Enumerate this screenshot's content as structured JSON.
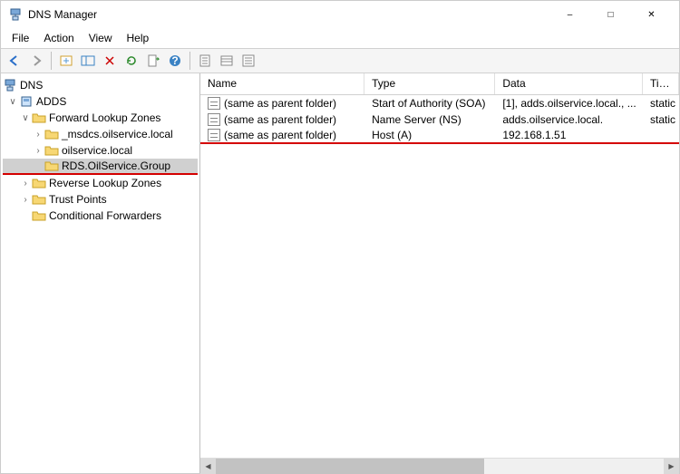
{
  "window": {
    "title": "DNS Manager"
  },
  "menu": {
    "file": "File",
    "action": "Action",
    "view": "View",
    "help": "Help"
  },
  "tree": {
    "root": "DNS",
    "server": "ADDS",
    "flz": "Forward Lookup Zones",
    "msdcs": "_msdcs.oilservice.local",
    "zone1": "oilservice.local",
    "zone2": "RDS.OilService.Group",
    "rlz": "Reverse Lookup Zones",
    "tp": "Trust Points",
    "cf": "Conditional Forwarders"
  },
  "columns": {
    "name": "Name",
    "type": "Type",
    "data": "Data",
    "timestamp": "Timestamp"
  },
  "records": [
    {
      "name": "(same as parent folder)",
      "type": "Start of Authority (SOA)",
      "data": "[1], adds.oilservice.local., ...",
      "timestamp": "static"
    },
    {
      "name": "(same as parent folder)",
      "type": "Name Server (NS)",
      "data": "adds.oilservice.local.",
      "timestamp": "static"
    },
    {
      "name": "(same as parent folder)",
      "type": "Host (A)",
      "data": "192.168.1.51",
      "timestamp": ""
    }
  ]
}
